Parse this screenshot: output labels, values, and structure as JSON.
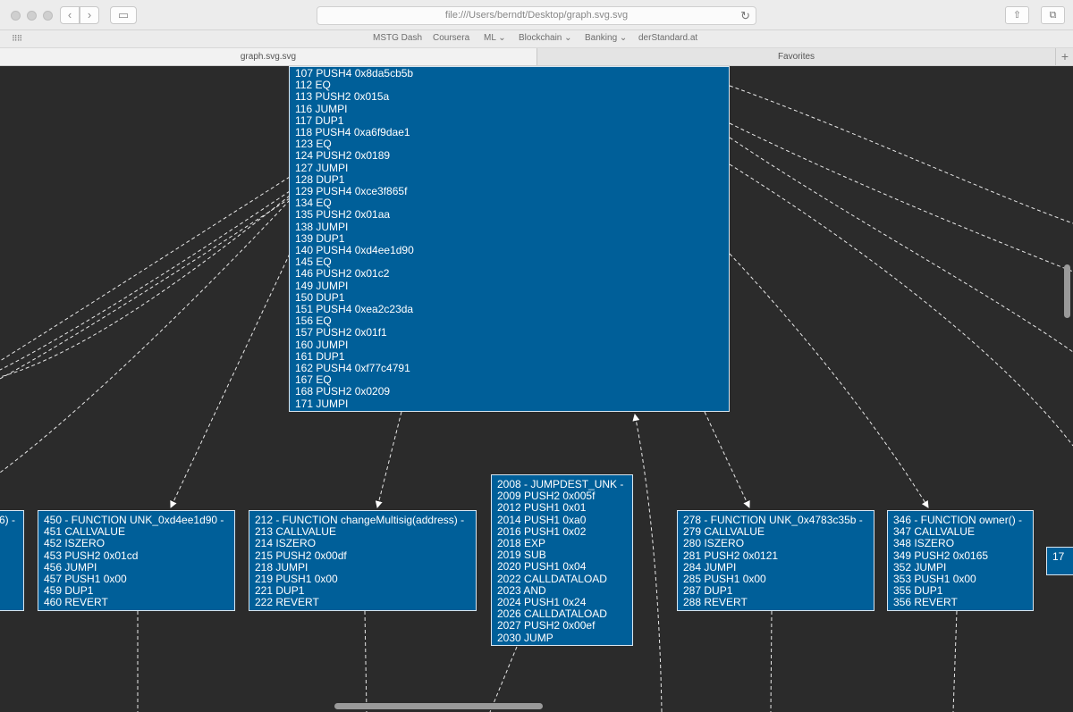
{
  "window": {
    "url": "file:///Users/berndt/Desktop/graph.svg.svg",
    "back_glyph": "‹",
    "forward_glyph": "›",
    "sidebar_glyph": "▭",
    "reload_glyph": "↻",
    "share_glyph": "⇧",
    "tabs_glyph": "⧉"
  },
  "favorites": {
    "grid_glyph": "⠿⠿",
    "items": [
      "MSTG Dash",
      "Coursera",
      "ML ⌄",
      "Blockchain ⌄",
      "Banking ⌄",
      "derStandard.at"
    ]
  },
  "tabs": [
    {
      "label": "graph.svg.svg",
      "active": true
    },
    {
      "label": "Favorites",
      "active": false
    }
  ],
  "tab_plus_glyph": "+",
  "graph": {
    "nodes": [
      {
        "id": "main",
        "text": "107 PUSH4 0x8da5cb5b\n112 EQ\n113 PUSH2 0x015a\n116 JUMPI\n117 DUP1\n118 PUSH4 0xa6f9dae1\n123 EQ\n124 PUSH2 0x0189\n127 JUMPI\n128 DUP1\n129 PUSH4 0xce3f865f\n134 EQ\n135 PUSH2 0x01aa\n138 JUMPI\n139 DUP1\n140 PUSH4 0xd4ee1d90\n145 EQ\n146 PUSH2 0x01c2\n149 JUMPI\n150 DUP1\n151 PUSH4 0xea2c23da\n156 EQ\n157 PUSH2 0x01f1\n160 JUMPI\n161 DUP1\n162 PUSH4 0xf77c4791\n167 EQ\n168 PUSH2 0x0209\n171 JUMPI"
      },
      {
        "id": "left-partial",
        "text": "6) -"
      },
      {
        "id": "fn-d4ee1d90",
        "text": "450 - FUNCTION UNK_0xd4ee1d90 -\n451 CALLVALUE\n452 ISZERO\n453 PUSH2 0x01cd\n456 JUMPI\n457 PUSH1 0x00\n459 DUP1\n460 REVERT"
      },
      {
        "id": "fn-changemultisig",
        "text": "212 - FUNCTION changeMultisig(address) -\n213 CALLVALUE\n214 ISZERO\n215 PUSH2 0x00df\n218 JUMPI\n219 PUSH1 0x00\n221 DUP1\n222 REVERT"
      },
      {
        "id": "jumpdest-2008",
        "text": "2008 - JUMPDEST_UNK -\n2009 PUSH2 0x005f\n2012 PUSH1 0x01\n2014 PUSH1 0xa0\n2016 PUSH1 0x02\n2018 EXP\n2019 SUB\n2020 PUSH1 0x04\n2022 CALLDATALOAD\n2023 AND\n2024 PUSH1 0x24\n2026 CALLDATALOAD\n2027 PUSH2 0x00ef\n2030 JUMP"
      },
      {
        "id": "fn-4783c35b",
        "text": "278 - FUNCTION UNK_0x4783c35b -\n279 CALLVALUE\n280 ISZERO\n281 PUSH2 0x0121\n284 JUMPI\n285 PUSH1 0x00\n287 DUP1\n288 REVERT"
      },
      {
        "id": "fn-owner",
        "text": "346 - FUNCTION owner() -\n347 CALLVALUE\n348 ISZERO\n349 PUSH2 0x0165\n352 JUMPI\n353 PUSH1 0x00\n355 DUP1\n356 REVERT"
      },
      {
        "id": "right-partial",
        "text": "17"
      }
    ],
    "colors": {
      "background": "#2b2b2b",
      "node_fill": "#005f99",
      "edge": "#e8e8e8"
    }
  }
}
